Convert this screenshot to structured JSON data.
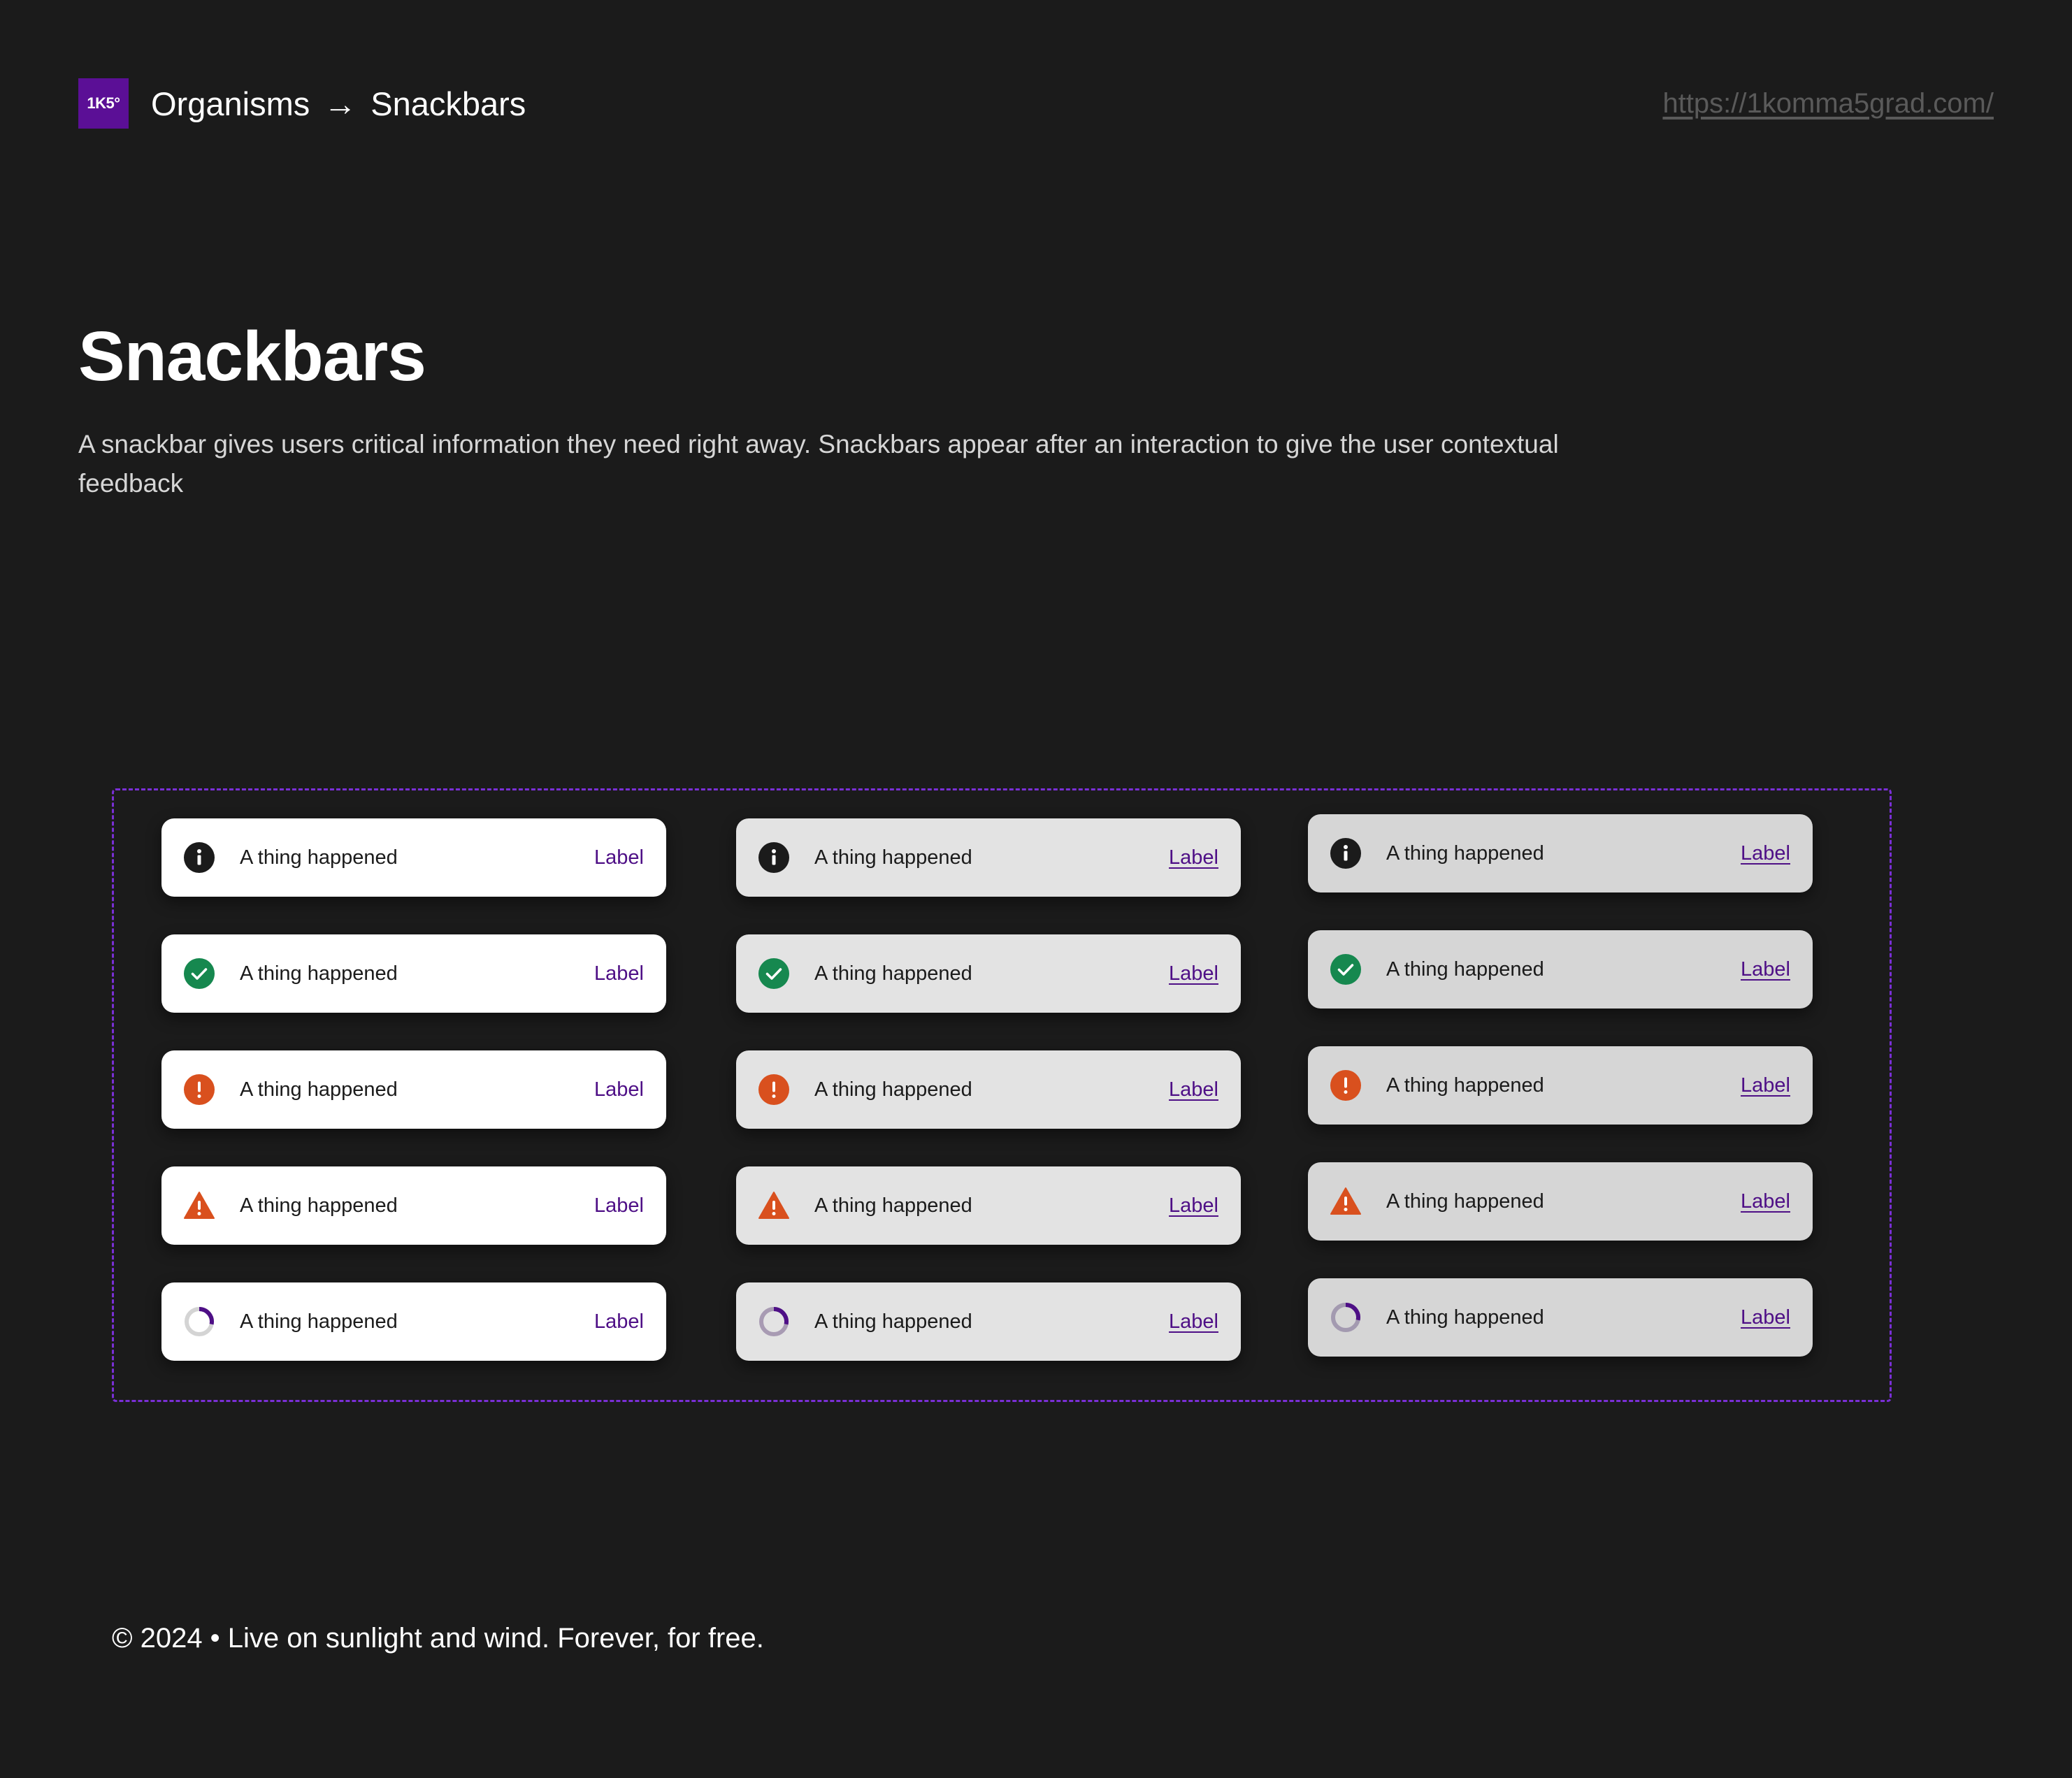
{
  "header": {
    "logo_text": "1K5°",
    "breadcrumb": [
      "Organisms",
      "Snackbars"
    ],
    "breadcrumb_separator": "→",
    "site_link": "https://1komma5grad.com/"
  },
  "page": {
    "title": "Snackbars",
    "description": "A snackbar gives users critical information they need right away. Snackbars appear after an interaction to give the user contextual feedback"
  },
  "colors": {
    "background": "#1b1b1b",
    "brand": "#5b0f96",
    "frame_border": "#7a2fd6",
    "action": "#4e0f86",
    "success": "#16884f",
    "error": "#d9501e",
    "info": "#1b1b1b",
    "loading": "#4e0f86"
  },
  "snackbars": {
    "columns": [
      {
        "variant": "white",
        "items": [
          {
            "icon": "info-icon",
            "message": "A thing happened",
            "action": "Label"
          },
          {
            "icon": "check-circle-icon",
            "message": "A thing happened",
            "action": "Label"
          },
          {
            "icon": "error-circle-icon",
            "message": "A thing happened",
            "action": "Label"
          },
          {
            "icon": "warning-triangle-icon",
            "message": "A thing happened",
            "action": "Label"
          },
          {
            "icon": "loading-spinner-icon",
            "message": "A thing happened",
            "action": "Label"
          }
        ]
      },
      {
        "variant": "light",
        "items": [
          {
            "icon": "info-icon",
            "message": "A thing happened",
            "action": "Label"
          },
          {
            "icon": "check-circle-icon",
            "message": "A thing happened",
            "action": "Label"
          },
          {
            "icon": "error-circle-icon",
            "message": "A thing happened",
            "action": "Label"
          },
          {
            "icon": "warning-triangle-icon",
            "message": "A thing happened",
            "action": "Label"
          },
          {
            "icon": "loading-spinner-icon",
            "message": "A thing happened",
            "action": "Label"
          }
        ]
      },
      {
        "variant": "mid",
        "items": [
          {
            "icon": "info-icon",
            "message": "A thing happened",
            "action": "Label"
          },
          {
            "icon": "check-circle-icon",
            "message": "A thing happened",
            "action": "Label"
          },
          {
            "icon": "error-circle-icon",
            "message": "A thing happened",
            "action": "Label"
          },
          {
            "icon": "warning-triangle-icon",
            "message": "A thing happened",
            "action": "Label"
          },
          {
            "icon": "loading-spinner-icon",
            "message": "A thing happened",
            "action": "Label"
          }
        ]
      }
    ]
  },
  "footer": {
    "text": "© 2024 • Live on sunlight and wind. Forever, for free."
  }
}
